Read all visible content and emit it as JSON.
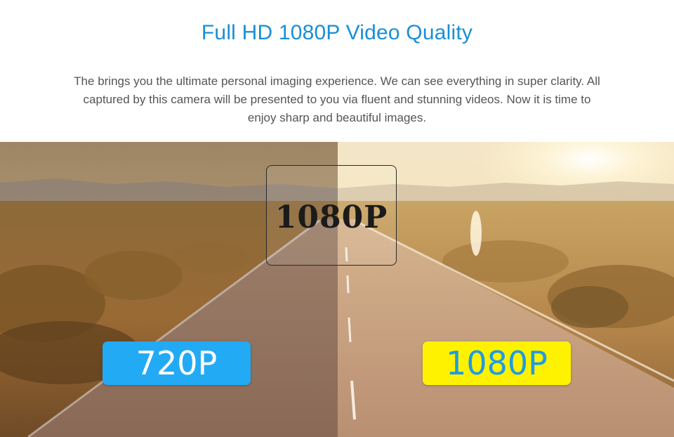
{
  "header": {
    "title": "Full HD 1080P Video Quality",
    "description": "The brings you the ultimate personal imaging experience. We can see everything in super clarity. All captured by this camera will be presented to you via fluent and stunning videos. Now it is time to enjoy sharp and beautiful images."
  },
  "comparison": {
    "center_label": "1080P",
    "left_badge": "720P",
    "right_badge": "1080P"
  },
  "colors": {
    "title": "#1a8fd6",
    "left_badge_bg": "#22aaf5",
    "right_badge_bg": "#fff200",
    "right_badge_text": "#1f9be4"
  }
}
